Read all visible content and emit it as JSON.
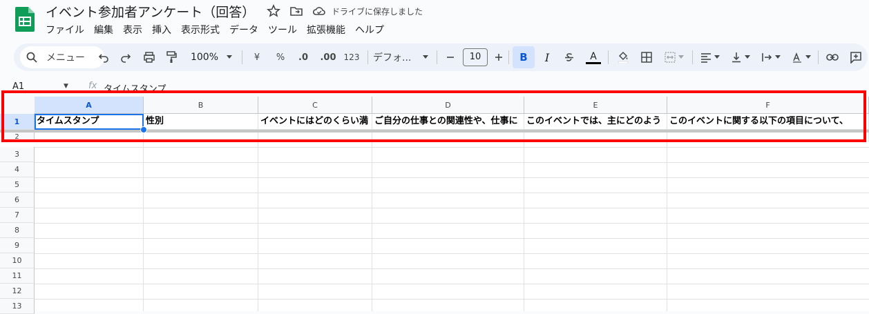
{
  "app": {
    "doc_title": "イベント参加者アンケート（回答）",
    "save_status": "ドライブに保存しました"
  },
  "menu": [
    "ファイル",
    "編集",
    "表示",
    "挿入",
    "表示形式",
    "データ",
    "ツール",
    "拡張機能",
    "ヘルプ"
  ],
  "toolbar": {
    "search_label": "メニュー",
    "zoom": "100%",
    "currency": "¥",
    "percent": "%",
    "decimal_decrease": ".0",
    "decimal_increase": ".00",
    "number_format": "123",
    "font_name": "デフォ...",
    "font_size": "10",
    "bold": "B",
    "italic": "I",
    "text_color_glyph": "A"
  },
  "formula_bar": {
    "cell_ref": "A1",
    "fx": "fx",
    "value": "タイムスタンプ"
  },
  "columns": [
    "A",
    "B",
    "C",
    "D",
    "E",
    "F"
  ],
  "rows": [
    "1",
    "2",
    "3",
    "4",
    "5",
    "6",
    "7",
    "8",
    "9",
    "10",
    "11",
    "12",
    "13"
  ],
  "header_row": [
    "タイムスタンプ",
    "性別",
    "イベントにはどのくらい満",
    "ご自分の仕事との関連性や、仕事に",
    "このイベントでは、主にどのよう",
    "このイベントに関する以下の項目について、"
  ],
  "colors": {
    "accent": "#1a73e8",
    "highlight": "#ff0000",
    "logo": "#0f9d58"
  }
}
